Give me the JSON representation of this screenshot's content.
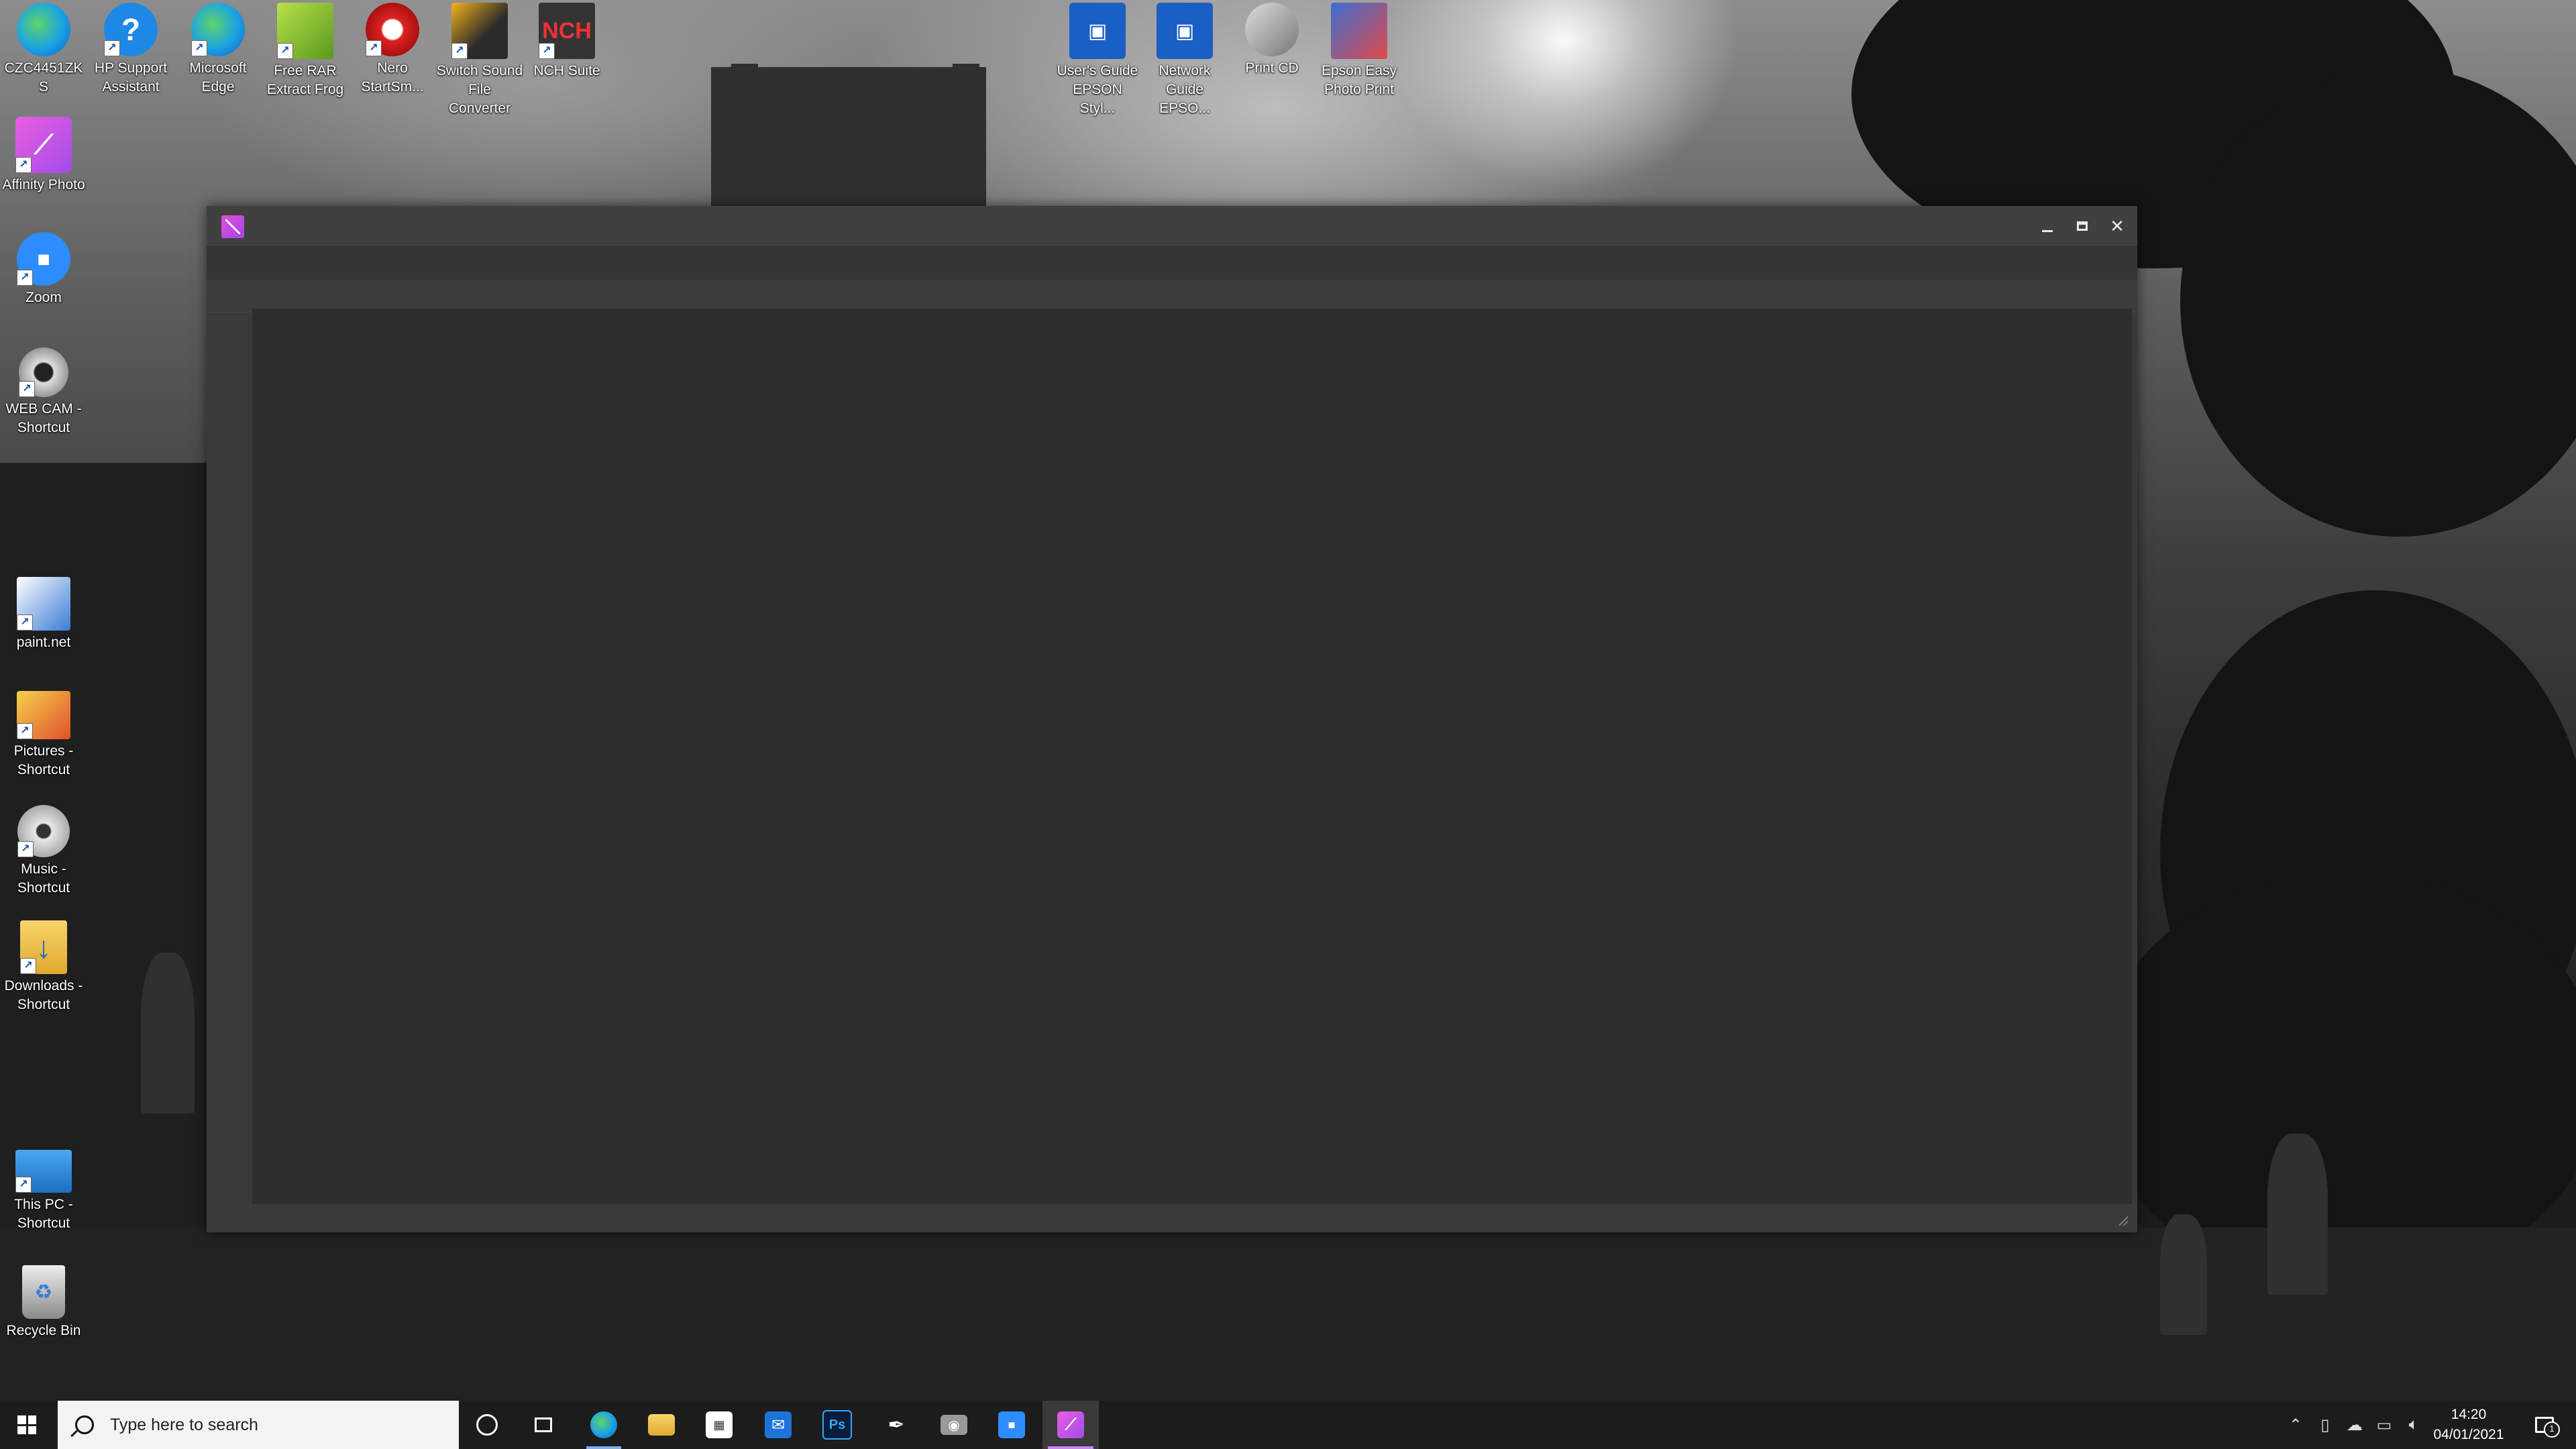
{
  "desktop": {
    "icons": [
      {
        "label": "CZC4451ZKS",
        "icon": "edge-icon"
      },
      {
        "label": "HP Support Assistant",
        "icon": "help-icon"
      },
      {
        "label": "Microsoft Edge",
        "icon": "edge-icon"
      },
      {
        "label": "Free RAR Extract Frog",
        "icon": "frog-icon"
      },
      {
        "label": "Nero StartSm...",
        "icon": "nero-icon"
      },
      {
        "label": "Switch Sound File Converter",
        "icon": "switch-icon"
      },
      {
        "label": "NCH Suite",
        "icon": "nch-icon"
      },
      {
        "label": "User's Guide EPSON Styl...",
        "icon": "epson-guide-icon"
      },
      {
        "label": "Network Guide EPSO...",
        "icon": "epson-network-icon"
      },
      {
        "label": "Print CD",
        "icon": "print-cd-icon"
      },
      {
        "label": "Epson Easy Photo Print",
        "icon": "epson-photo-icon"
      },
      {
        "label": "Affinity Photo",
        "icon": "affinity-photo-icon"
      },
      {
        "label": "Zoom",
        "icon": "zoom-icon"
      },
      {
        "label": "WEB CAM - Shortcut",
        "icon": "webcam-icon"
      },
      {
        "label": "paint.net",
        "icon": "paintnet-icon"
      },
      {
        "label": "Pictures - Shortcut",
        "icon": "pictures-icon"
      },
      {
        "label": "Music - Shortcut",
        "icon": "music-icon"
      },
      {
        "label": "Downloads - Shortcut",
        "icon": "downloads-icon"
      },
      {
        "label": "This PC - Shortcut",
        "icon": "this-pc-icon"
      },
      {
        "label": "Recycle Bin",
        "icon": "recycle-bin-icon"
      }
    ]
  },
  "window": {
    "app_icon": "affinity-photo-icon",
    "title": "",
    "minimize": "minimize-icon",
    "maximize": "maximize-icon",
    "close": "close-icon"
  },
  "taskbar": {
    "search_placeholder": "Type here to search",
    "apps": [
      {
        "name": "cortana",
        "icon": "cortana-icon"
      },
      {
        "name": "task-view",
        "icon": "task-view-icon"
      },
      {
        "name": "edge",
        "icon": "edge-icon"
      },
      {
        "name": "file-explorer",
        "icon": "folder-icon"
      },
      {
        "name": "store",
        "icon": "store-icon"
      },
      {
        "name": "mail",
        "icon": "mail-icon"
      },
      {
        "name": "photoshop",
        "icon": "photoshop-icon",
        "text": "Ps"
      },
      {
        "name": "pen",
        "icon": "pen-icon"
      },
      {
        "name": "camera",
        "icon": "camera-icon"
      },
      {
        "name": "zoom",
        "icon": "zoom-icon"
      },
      {
        "name": "affinity-photo",
        "icon": "affinity-photo-icon",
        "active": true
      }
    ],
    "tray": [
      "chevron-up-icon",
      "device-icon",
      "onedrive-icon",
      "network-icon",
      "volume-icon"
    ],
    "time": "14:20",
    "date": "04/01/2021",
    "notification_count": "1"
  },
  "colors": {
    "taskbar_bg": "#1c1c1c",
    "window_bg": "#3a3a3a",
    "workspace_bg": "#2e2e2e",
    "affinity_accent": "#c886ee"
  }
}
